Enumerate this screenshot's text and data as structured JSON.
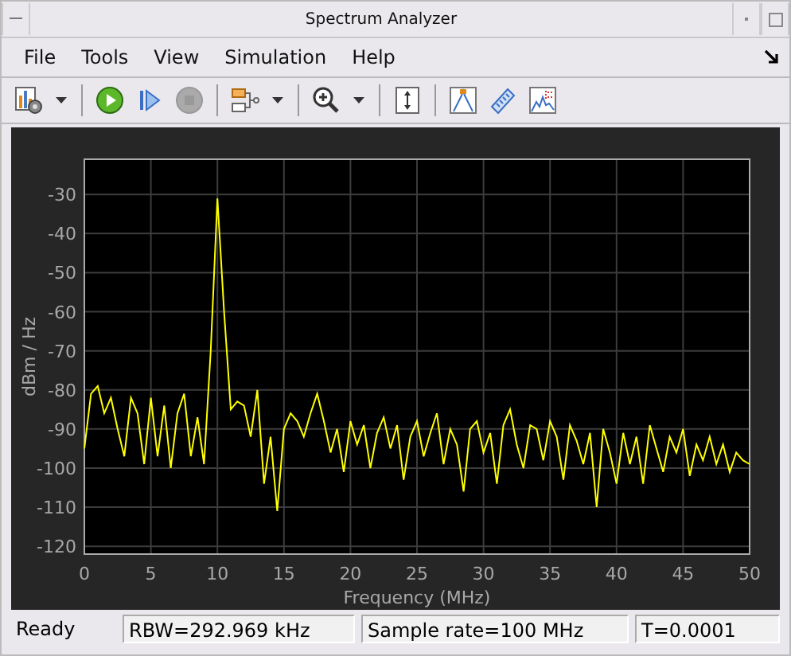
{
  "window": {
    "title": "Spectrum Analyzer"
  },
  "menu": [
    {
      "label": "File"
    },
    {
      "label": "Tools"
    },
    {
      "label": "View"
    },
    {
      "label": "Simulation"
    },
    {
      "label": "Help"
    }
  ],
  "plot": {
    "chart_data": {
      "type": "line",
      "grid": true,
      "xlabel": "Frequency (MHz)",
      "ylabel": "dBm / Hz",
      "xlim": [
        0,
        50
      ],
      "ylim": [
        -122,
        -21
      ],
      "xticks": [
        0,
        5,
        10,
        15,
        20,
        25,
        30,
        35,
        40,
        45,
        50
      ],
      "yticks": [
        -120,
        -110,
        -100,
        -90,
        -80,
        -70,
        -60,
        -50,
        -40,
        -30
      ],
      "x": [
        0,
        0.5,
        1,
        1.5,
        2,
        2.5,
        3,
        3.5,
        4,
        4.5,
        5,
        5.5,
        6,
        6.5,
        7,
        7.5,
        8,
        8.5,
        9,
        9.5,
        10,
        10.5,
        11,
        11.5,
        12,
        12.5,
        13,
        13.5,
        14,
        14.5,
        15,
        15.5,
        16,
        16.5,
        17,
        17.5,
        18,
        18.5,
        19,
        19.5,
        20,
        20.5,
        21,
        21.5,
        22,
        22.5,
        23,
        23.5,
        24,
        24.5,
        25,
        25.5,
        26,
        26.5,
        27,
        27.5,
        28,
        28.5,
        29,
        29.5,
        30,
        30.5,
        31,
        31.5,
        32,
        32.5,
        33,
        33.5,
        34,
        34.5,
        35,
        35.5,
        36,
        36.5,
        37,
        37.5,
        38,
        38.5,
        39,
        39.5,
        40,
        40.5,
        41,
        41.5,
        42,
        42.5,
        43,
        43.5,
        44,
        44.5,
        45,
        45.5,
        46,
        46.5,
        47,
        47.5,
        48,
        48.5,
        49,
        49.5,
        50
      ],
      "series": [
        {
          "color": "#ffff00",
          "values": [
            -95,
            -81,
            -79,
            -86,
            -82,
            -90,
            -97,
            -82,
            -86,
            -99,
            -82,
            -97,
            -84,
            -100,
            -86,
            -81,
            -97,
            -87,
            -99,
            -70,
            -31,
            -60,
            -85,
            -83,
            -84,
            -92,
            -80,
            -104,
            -92,
            -111,
            -90,
            -86,
            -88,
            -92,
            -86,
            -81,
            -88,
            -96,
            -90,
            -101,
            -88,
            -94,
            -89,
            -100,
            -91,
            -87,
            -95,
            -89,
            -103,
            -92,
            -88,
            -97,
            -91,
            -86,
            -99,
            -90,
            -94,
            -106,
            -90,
            -88,
            -96,
            -91,
            -104,
            -89,
            -85,
            -94,
            -100,
            -89,
            -90,
            -98,
            -88,
            -92,
            -103,
            -89,
            -93,
            -99,
            -91,
            -110,
            -90,
            -96,
            -104,
            -91,
            -99,
            -92,
            -104,
            -89,
            -95,
            -101,
            -92,
            -96,
            -90,
            -102,
            -94,
            -98,
            -92,
            -99,
            -94,
            -101,
            -96,
            -98,
            -99
          ]
        }
      ]
    }
  },
  "status_bar": [
    {
      "kind": "plain",
      "text": "Ready"
    },
    {
      "kind": "field",
      "text": "RBW=292.969 kHz"
    },
    {
      "kind": "field",
      "text": "Sample rate=100 MHz"
    },
    {
      "kind": "field",
      "text": "T=0.0001"
    }
  ]
}
